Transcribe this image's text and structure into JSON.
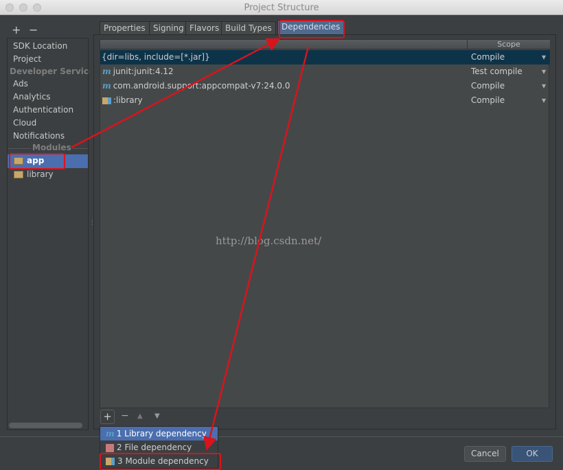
{
  "window": {
    "title": "Project Structure"
  },
  "sidebar": {
    "add": "+",
    "remove": "−",
    "items": [
      {
        "label": "SDK Location"
      },
      {
        "label": "Project"
      }
    ],
    "dev_header": "Developer Services",
    "dev_items": [
      {
        "label": "Ads"
      },
      {
        "label": "Analytics"
      },
      {
        "label": "Authentication"
      },
      {
        "label": "Cloud"
      },
      {
        "label": "Notifications"
      }
    ],
    "modules_header": "Modules",
    "modules": [
      {
        "label": "app",
        "selected": true
      },
      {
        "label": "library"
      }
    ]
  },
  "tabs": [
    {
      "label": "Properties"
    },
    {
      "label": "Signing"
    },
    {
      "label": "Flavors"
    },
    {
      "label": "Build Types"
    },
    {
      "label": "Dependencies",
      "active": true
    }
  ],
  "table": {
    "scope_header": "Scope",
    "rows": [
      {
        "name": "{dir=libs, include=[*.jar]}",
        "scope": "Compile",
        "icon": "none",
        "selected": true
      },
      {
        "name": "junit:junit:4.12",
        "scope": "Test compile",
        "icon": "maven-icon"
      },
      {
        "name": "com.android.support:appcompat-v7:24.0.0",
        "scope": "Compile",
        "icon": "maven-icon"
      },
      {
        "name": ":library",
        "scope": "Compile",
        "icon": "module-icon"
      }
    ]
  },
  "toolbar": {
    "add": "+",
    "remove": "−",
    "up": "▲",
    "down": "▼"
  },
  "popup": [
    {
      "label": "1  Library dependency",
      "selected": true
    },
    {
      "label": "2  File dependency"
    },
    {
      "label": "3  Module dependency"
    }
  ],
  "watermark": "http://blog.csdn.net/",
  "buttons": {
    "cancel": "Cancel",
    "ok": "OK"
  },
  "colors": {
    "accent": "#4b6eaf",
    "annotation": "#d8141c",
    "selected_row": "#0d3349"
  }
}
